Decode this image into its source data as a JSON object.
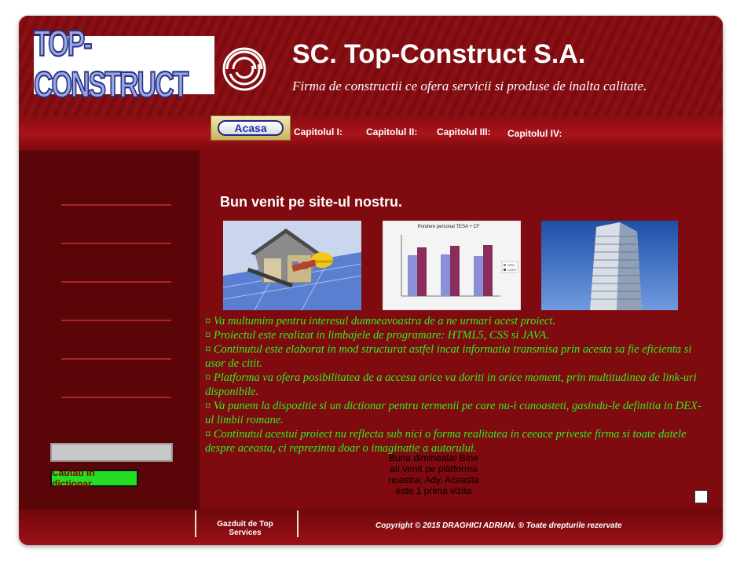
{
  "header": {
    "logo_text": "TOP-CONSTRUCT",
    "title": "SC. Top-Construct S.A.",
    "subtitle": "Firma de constructii ce ofera servicii si produse de inalta calitate."
  },
  "nav": {
    "home": "Acasa",
    "links": [
      "Capitolul I:",
      "Capitolul II:",
      "Capitolul III:",
      "Capitolul IV:"
    ]
  },
  "sidebar": {
    "search_placeholder": "",
    "search_button": "Cautati in dictionar"
  },
  "main": {
    "welcome": "Bun venit pe site-ul nostru.",
    "chart_title": "Pondere personal TESA + CF",
    "chart_legend": [
      "SPM",
      "CONT"
    ],
    "bullets": [
      "¤ Va multumim pentru interesul dumneavoastra de a ne urmari acest proiect.",
      "¤ Proiectul este realizat in limbajele de programare: HTML5, CSS si JAVA.",
      "¤ Continutul este elaborat in mod structurat astfel incat informatia transmisa prin acesta sa fie eficienta si usor de citit.",
      "¤ Platforma va ofera posibilitatea de a accesa orice va doriti in orice moment, prin multitudinea de link-uri disponibile.",
      "¤ Va punem la dispozitie si un dictionar pentru termenii pe care nu-i cunoasteti, gasindu-le definitia in DEX-ul limbii romane.",
      "¤ Continutul acestui proiect nu reflecta sub nici o forma realitatea in ceeace priveste firma si toate datele despre aceasta, ci reprezinta doar o imaginatie a autorului."
    ],
    "greeting": "Buna dimineata! Bine ati venit pe platforma noastra, Ady. Aceasta este 1 prima vizita"
  },
  "footer": {
    "hosted": "Gazduit de Top Services",
    "copyright": "Copyright © 2015 DRAGHICI ADRIAN. ® Toate drepturile rezervate"
  },
  "colors": {
    "background": "#7f0a0f",
    "sidebar": "#5a0508",
    "accent_green": "#33ee22",
    "link_blue": "#1e30b4"
  }
}
